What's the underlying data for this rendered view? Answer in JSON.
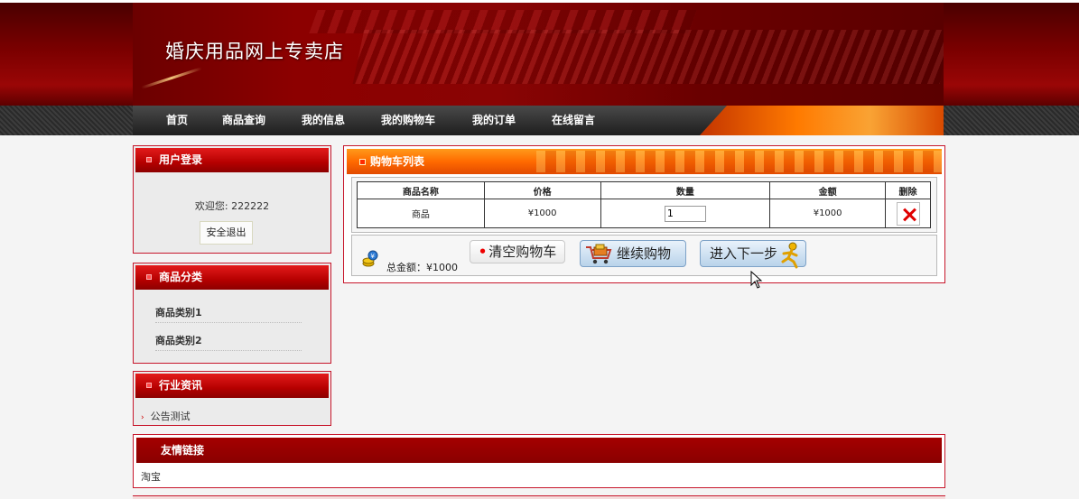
{
  "site": {
    "title": "婚庆用品网上专卖店"
  },
  "nav": {
    "items": [
      "首页",
      "商品查询",
      "我的信息",
      "我的购物车",
      "我的订单",
      "在线留言"
    ]
  },
  "user_box": {
    "title": "用户登录",
    "welcome": "欢迎您: 222222",
    "logout_label": "安全退出"
  },
  "category_box": {
    "title": "商品分类",
    "items": [
      "商品类别1",
      "商品类别2"
    ]
  },
  "news_box": {
    "title": "行业资讯",
    "items": [
      "公告测试"
    ]
  },
  "cart": {
    "title": "购物车列表",
    "columns": [
      "商品名称",
      "价格",
      "数量",
      "金额",
      "删除"
    ],
    "rows": [
      {
        "name": "商品",
        "price": "¥1000",
        "quantity": "1",
        "amount": "¥1000"
      }
    ],
    "total_label": "总金额：¥1000",
    "clear_label": "清空购物车",
    "continue_label": "继续购物",
    "next_label": "进入下一步"
  },
  "links_box": {
    "title": "友情链接",
    "items": [
      "淘宝"
    ]
  },
  "colors": {
    "brand_red": "#c7162b",
    "header_dark": "#6b0000",
    "cart_orange": "#ff6a00"
  }
}
